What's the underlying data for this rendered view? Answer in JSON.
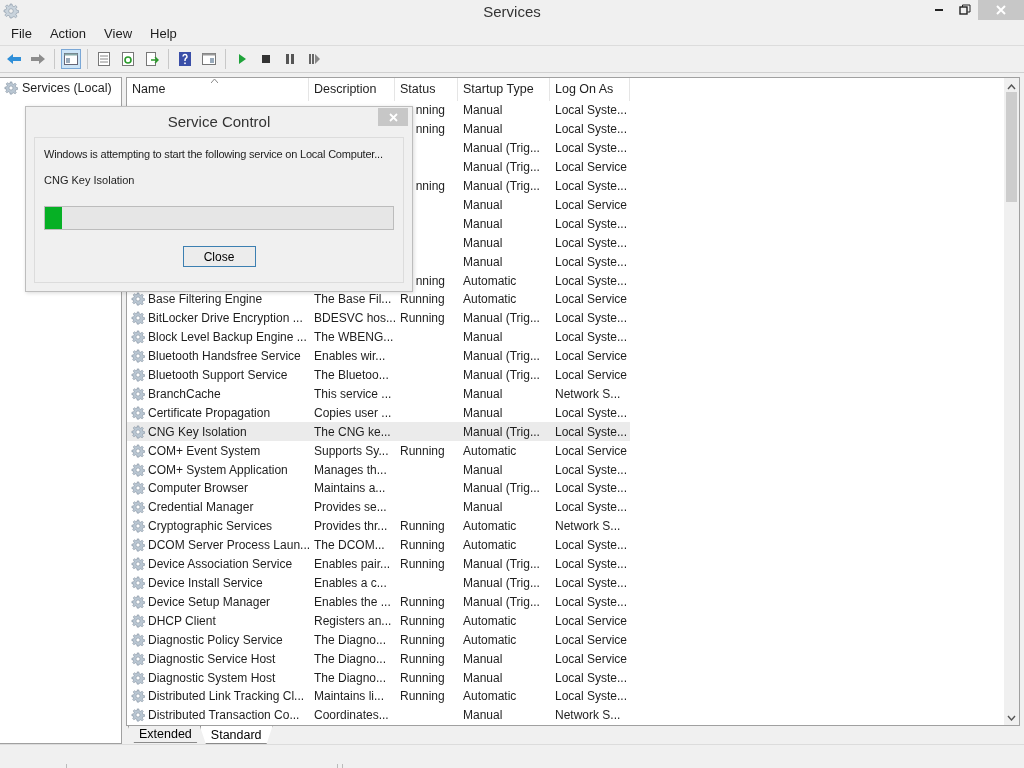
{
  "window": {
    "title": "Services"
  },
  "menu": [
    {
      "label": "File"
    },
    {
      "label": "Action"
    },
    {
      "label": "View"
    },
    {
      "label": "Help"
    }
  ],
  "tree": [
    {
      "label": "Services (Local)",
      "selected": false
    }
  ],
  "table": {
    "columns": [
      "Name",
      "Description",
      "Status",
      "Startup Type",
      "Log On As"
    ],
    "rows": [
      {
        "kind": "covered",
        "status": "nning",
        "startup_type": "Manual",
        "log_on_as": "Local Syste...",
        "selected": false
      },
      {
        "kind": "covered",
        "status": "nning",
        "startup_type": "Manual",
        "log_on_as": "Local Syste...",
        "selected": false
      },
      {
        "kind": "covered",
        "startup_type": "Manual (Trig...",
        "log_on_as": "Local Syste...",
        "selected": false
      },
      {
        "kind": "covered",
        "startup_type": "Manual (Trig...",
        "log_on_as": "Local Service",
        "selected": false
      },
      {
        "kind": "covered",
        "status": "nning",
        "startup_type": "Manual (Trig...",
        "log_on_as": "Local Syste...",
        "selected": false
      },
      {
        "kind": "covered",
        "startup_type": "Manual",
        "log_on_as": "Local Service",
        "selected": false
      },
      {
        "kind": "covered",
        "startup_type": "Manual",
        "log_on_as": "Local Syste...",
        "selected": false
      },
      {
        "kind": "covered",
        "startup_type": "Manual",
        "log_on_as": "Local Syste...",
        "selected": false
      },
      {
        "kind": "covered",
        "startup_type": "Manual",
        "log_on_as": "Local Syste...",
        "selected": false
      },
      {
        "kind": "covered",
        "status": "nning",
        "startup_type": "Automatic",
        "log_on_as": "Local Syste...",
        "selected": false
      },
      {
        "kind": "service",
        "name": "Base Filtering Engine",
        "description": "The Base Fil...",
        "status": "Running",
        "startup_type": "Automatic",
        "log_on_as": "Local Service",
        "selected": false
      },
      {
        "kind": "service",
        "name": "BitLocker Drive Encryption ...",
        "description": "BDESVC hos...",
        "status": "Running",
        "startup_type": "Manual (Trig...",
        "log_on_as": "Local Syste...",
        "selected": false
      },
      {
        "kind": "service",
        "name": "Block Level Backup Engine ...",
        "description": "The WBENG...",
        "startup_type": "Manual",
        "log_on_as": "Local Syste...",
        "selected": false
      },
      {
        "kind": "service",
        "name": "Bluetooth Handsfree Service",
        "description": "Enables wir...",
        "startup_type": "Manual (Trig...",
        "log_on_as": "Local Service",
        "selected": false
      },
      {
        "kind": "service",
        "name": "Bluetooth Support Service",
        "description": "The Bluetoo...",
        "startup_type": "Manual (Trig...",
        "log_on_as": "Local Service",
        "selected": false
      },
      {
        "kind": "service",
        "name": "BranchCache",
        "description": "This service ...",
        "startup_type": "Manual",
        "log_on_as": "Network S...",
        "selected": false
      },
      {
        "kind": "service",
        "name": "Certificate Propagation",
        "description": "Copies user ...",
        "startup_type": "Manual",
        "log_on_as": "Local Syste...",
        "selected": false
      },
      {
        "kind": "service",
        "name": "CNG Key Isolation",
        "description": "The CNG ke...",
        "startup_type": "Manual (Trig...",
        "log_on_as": "Local Syste...",
        "selected": true
      },
      {
        "kind": "service",
        "name": "COM+ Event System",
        "description": "Supports Sy...",
        "status": "Running",
        "startup_type": "Automatic",
        "log_on_as": "Local Service",
        "selected": false
      },
      {
        "kind": "service",
        "name": "COM+ System Application",
        "description": "Manages th...",
        "startup_type": "Manual",
        "log_on_as": "Local Syste...",
        "selected": false
      },
      {
        "kind": "service",
        "name": "Computer Browser",
        "description": "Maintains a...",
        "startup_type": "Manual (Trig...",
        "log_on_as": "Local Syste...",
        "selected": false
      },
      {
        "kind": "service",
        "name": "Credential Manager",
        "description": "Provides se...",
        "startup_type": "Manual",
        "log_on_as": "Local Syste...",
        "selected": false
      },
      {
        "kind": "service",
        "name": "Cryptographic Services",
        "description": "Provides thr...",
        "status": "Running",
        "startup_type": "Automatic",
        "log_on_as": "Network S...",
        "selected": false
      },
      {
        "kind": "service",
        "name": "DCOM Server Process Laun...",
        "description": "The DCOM...",
        "status": "Running",
        "startup_type": "Automatic",
        "log_on_as": "Local Syste...",
        "selected": false
      },
      {
        "kind": "service",
        "name": "Device Association Service",
        "description": "Enables pair...",
        "status": "Running",
        "startup_type": "Manual (Trig...",
        "log_on_as": "Local Syste...",
        "selected": false
      },
      {
        "kind": "service",
        "name": "Device Install Service",
        "description": "Enables a c...",
        "startup_type": "Manual (Trig...",
        "log_on_as": "Local Syste...",
        "selected": false
      },
      {
        "kind": "service",
        "name": "Device Setup Manager",
        "description": "Enables the ...",
        "status": "Running",
        "startup_type": "Manual (Trig...",
        "log_on_as": "Local Syste...",
        "selected": false
      },
      {
        "kind": "service",
        "name": "DHCP Client",
        "description": "Registers an...",
        "status": "Running",
        "startup_type": "Automatic",
        "log_on_as": "Local Service",
        "selected": false
      },
      {
        "kind": "service",
        "name": "Diagnostic Policy Service",
        "description": "The Diagno...",
        "status": "Running",
        "startup_type": "Automatic",
        "log_on_as": "Local Service",
        "selected": false
      },
      {
        "kind": "service",
        "name": "Diagnostic Service Host",
        "description": "The Diagno...",
        "status": "Running",
        "startup_type": "Manual",
        "log_on_as": "Local Service",
        "selected": false
      },
      {
        "kind": "service",
        "name": "Diagnostic System Host",
        "description": "The Diagno...",
        "status": "Running",
        "startup_type": "Manual",
        "log_on_as": "Local Syste...",
        "selected": false
      },
      {
        "kind": "service",
        "name": "Distributed Link Tracking Cl...",
        "description": "Maintains li...",
        "status": "Running",
        "startup_type": "Automatic",
        "log_on_as": "Local Syste...",
        "selected": false
      },
      {
        "kind": "service",
        "name": "Distributed Transaction Co...",
        "description": "Coordinates...",
        "startup_type": "Manual",
        "log_on_as": "Network S...",
        "selected": false
      }
    ]
  },
  "tabs": [
    {
      "label": "Extended",
      "selected": false
    },
    {
      "label": "Standard",
      "selected": true
    }
  ],
  "dialog": {
    "title": "Service Control",
    "message": "Windows is attempting to start the following service on Local Computer...",
    "service": "CNG Key Isolation",
    "progress": {
      "level": 0.05
    },
    "button": "Close"
  }
}
